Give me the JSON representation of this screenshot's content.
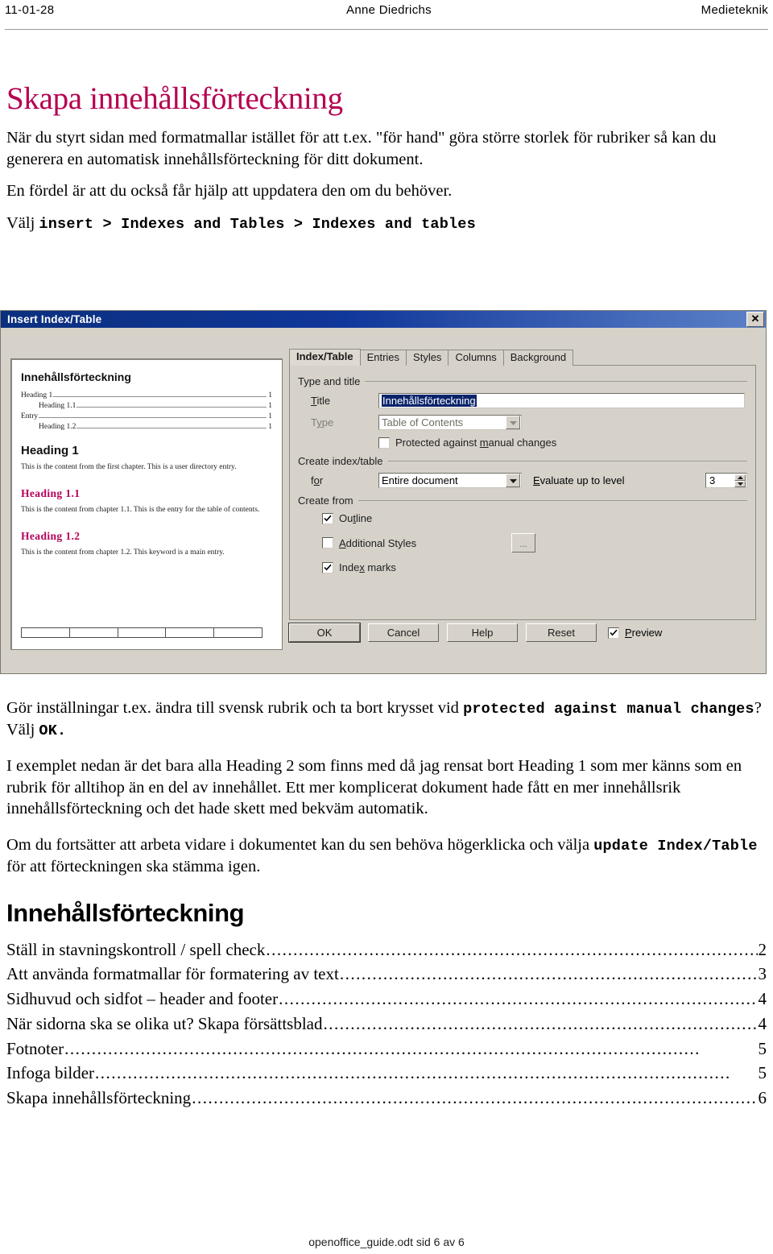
{
  "page_header": {
    "date": "11-01-28",
    "author": "Anne Diedrichs",
    "course": "Medieteknik"
  },
  "doc": {
    "title": "Skapa innehållsförteckning",
    "title_color": "#b50050",
    "paragraph_1": "När du styrt sidan med formatmallar istället för att t.ex. \"för hand\" göra större storlek för rubriker så kan du generera en automatisk innehållsförteckning för ditt dokument.",
    "paragraph_2": "En fördel är att du också får hjälp att uppdatera den om du behöver.",
    "menu_intro": "Välj ",
    "menu_path": "insert > Indexes and Tables > Indexes and tables",
    "after_1_a": "Gör inställningar t.ex. ändra till svensk rubrik och ta bort krysset vid ",
    "after_1_mono_a": "protected against manual changes",
    "after_1_b": "? Välj ",
    "after_1_mono_b": "OK.",
    "paragraph_3": "I exemplet nedan är det bara alla Heading 2 som finns med då jag rensat bort Heading 1 som mer känns som en rubrik för alltihop än en del av innehållet. Ett mer komplicerat dokument hade fått en mer innehållsrik innehållsförteckning och det hade skett med bekväm automatik.",
    "paragraph_4_a": "Om du fortsätter att arbeta vidare i dokumentet kan du sen behöva högerklicka och välja ",
    "paragraph_4_mono": "update Index/Table",
    "paragraph_4_b": " för att förteckningen ska stämma igen."
  },
  "dialog": {
    "window_title": "Insert Index/Table",
    "close_label": "✕",
    "tabs": [
      {
        "label": "Index/Table",
        "active": true
      },
      {
        "label": "Entries",
        "active": false
      },
      {
        "label": "Styles",
        "active": false
      },
      {
        "label": "Columns",
        "active": false
      },
      {
        "label": "Background",
        "active": false
      }
    ],
    "group_type_and_title": "Type and title",
    "label_title": "Title",
    "value_title": "Innehållsförteckning",
    "label_type": "Type",
    "value_type": "Table of Contents",
    "checkbox_protected": "Protected against manual changes",
    "checkbox_protected_checked": false,
    "group_create_index": "Create index/table",
    "label_for": "for",
    "value_for": "Entire document",
    "label_evaluate": "Evaluate up to level",
    "value_evaluate": "3",
    "group_create_from": "Create from",
    "checkbox_outline": "Outline",
    "checkbox_outline_checked": true,
    "checkbox_additional_styles": "Additional Styles",
    "checkbox_additional_styles_checked": false,
    "styles_browse_button": "...",
    "checkbox_index_marks": "Index marks",
    "checkbox_index_marks_checked": true,
    "button_ok": "OK",
    "button_cancel": "Cancel",
    "button_help": "Help",
    "button_reset": "Reset",
    "checkbox_preview": "Preview",
    "checkbox_preview_checked": true,
    "preview": {
      "title": "Innehållsförteckning",
      "toc_entries": [
        {
          "label": "Heading 1",
          "page": "1",
          "indent": false
        },
        {
          "label": "Heading 1.1",
          "page": "1",
          "indent": true
        },
        {
          "label": "Entry",
          "page": "1",
          "indent": false
        },
        {
          "label": "Heading 1.2",
          "page": "1",
          "indent": true
        }
      ],
      "h1": "Heading 1",
      "h1_text": "This is the content from the first chapter. This is a user directory entry.",
      "h2a": "Heading 1.1",
      "h2a_text": "This is the content from chapter 1.1. This is the entry for the table of contents.",
      "h2b": "Heading 1.2",
      "h2b_text": "This is the content from chapter 1.2. This keyword is a main entry.",
      "heading_color": "#b5005a",
      "table_columns": 5
    }
  },
  "toc_section": {
    "heading": "Innehållsförteckning",
    "entries": [
      {
        "label": "Ställ in stavningskontroll / spell check",
        "page": "2"
      },
      {
        "label": "Att använda formatmallar för formatering av text",
        "page": "3"
      },
      {
        "label": "Sidhuvud och sidfot – header and footer",
        "page": "4"
      },
      {
        "label": "När sidorna ska se olika ut? Skapa försättsblad",
        "page": "4"
      },
      {
        "label": "Fotnoter",
        "page": "5"
      },
      {
        "label": "Infoga bilder",
        "page": "5"
      },
      {
        "label": "Skapa innehållsförteckning",
        "page": "6"
      }
    ],
    "leader_char": "."
  },
  "page_footer": {
    "text": "openoffice_guide.odt sid 6 av 6"
  }
}
